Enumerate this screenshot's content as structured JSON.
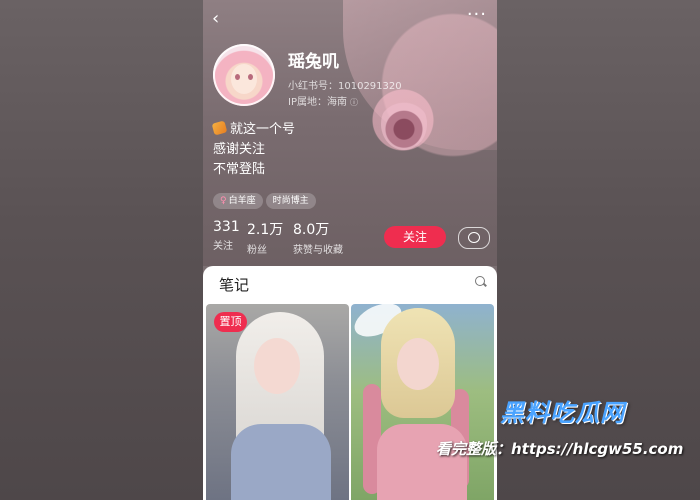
{
  "profile": {
    "name": "瑶兔叽",
    "red_id": "小红书号：1010291320",
    "ip_location": "IP属地：海南",
    "bio": [
      "就这一个号",
      "感谢关注",
      "不常登陆"
    ],
    "tags": [
      {
        "symbol": "♀",
        "label": "白羊座"
      },
      {
        "label": "时尚博主"
      }
    ],
    "stats": [
      {
        "value": "331",
        "label": "关注"
      },
      {
        "value": "2.1万",
        "label": "粉丝"
      },
      {
        "value": "8.0万",
        "label": "获赞与收藏"
      }
    ],
    "follow_label": "关注"
  },
  "nav": {
    "back_icon": "‹",
    "more_icon": "···",
    "info_icon": "ⓘ"
  },
  "notes": {
    "title": "笔记",
    "pinned_label": "置顶"
  },
  "watermark": {
    "brand": "黑料吃瓜网",
    "url_text": "看完整版：https://hlcgw55.com"
  },
  "colors": {
    "accent": "#ef2d4f"
  }
}
